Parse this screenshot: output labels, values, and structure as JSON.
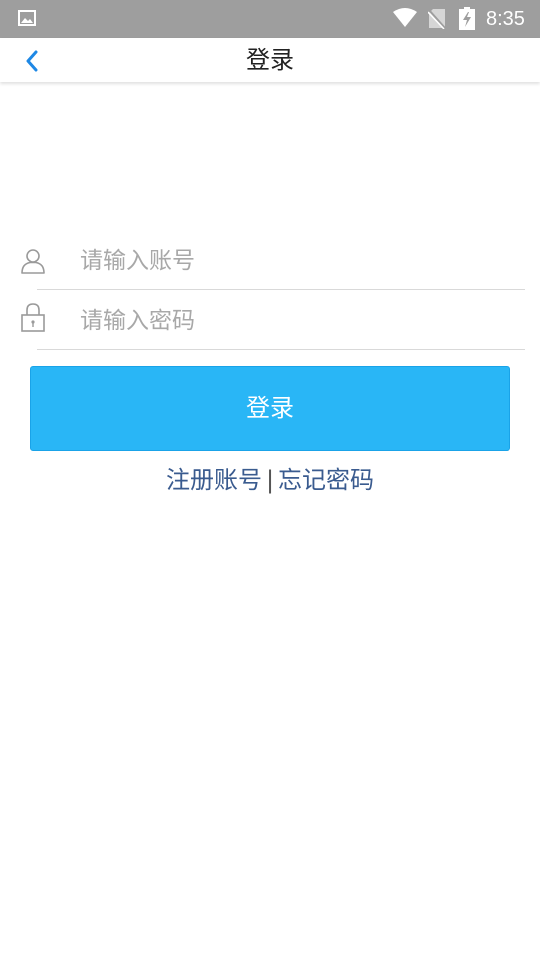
{
  "status_bar": {
    "time": "8:35",
    "icons": [
      "gallery-icon",
      "wifi-icon",
      "no-sim-icon",
      "battery-charging-icon"
    ]
  },
  "header": {
    "title": "登录",
    "back_icon": "chevron-left-icon"
  },
  "form": {
    "account": {
      "icon": "user-icon",
      "placeholder": "请输入账号",
      "value": ""
    },
    "password": {
      "icon": "lock-icon",
      "placeholder": "请输入密码",
      "value": ""
    },
    "login_label": "登录"
  },
  "links": {
    "register": "注册账号",
    "separator": "|",
    "forgot": "忘记密码"
  },
  "colors": {
    "status_bar": "#9e9e9e",
    "accent": "#29b6f6",
    "back_icon": "#1e88e5",
    "link": "#3a5b8f"
  }
}
